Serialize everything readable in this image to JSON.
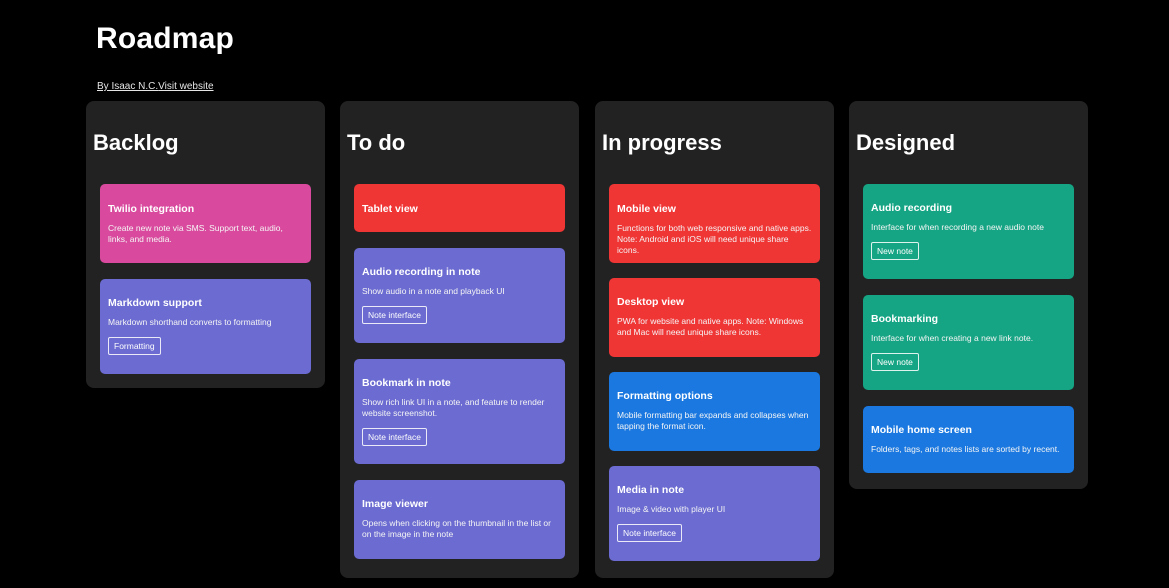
{
  "page": {
    "title": "Roadmap",
    "author": "By Isaac N.C.",
    "website_link": "Visit website"
  },
  "colors": {
    "background": "#000000",
    "column": "#222222",
    "pink": "#d94a9e",
    "purple": "#6b6bd1",
    "red": "#f03535",
    "blue": "#1a78e0",
    "teal": "#16a584"
  },
  "columns": [
    {
      "title": "Backlog",
      "cards": [
        {
          "title": "Twilio integration",
          "desc": "Create new note via SMS. Support text, audio, links, and media.",
          "tag": "",
          "color": "#d94a9e"
        },
        {
          "title": "Markdown support",
          "desc": "Markdown shorthand converts to formatting",
          "tag": "Formatting",
          "color": "#6b6bd1"
        }
      ]
    },
    {
      "title": "To do",
      "cards": [
        {
          "title": "Tablet view",
          "desc": "",
          "tag": "",
          "color": "#f03535"
        },
        {
          "title": "Audio recording in note",
          "desc": "Show audio in a note and playback UI",
          "tag": "Note interface",
          "color": "#6b6bd1"
        },
        {
          "title": "Bookmark in note",
          "desc": "Show rich link UI in a note, and feature to render website screenshot.",
          "tag": "Note interface",
          "color": "#6b6bd1"
        },
        {
          "title": "Image viewer",
          "desc": "Opens when clicking on the thumbnail in the list or on the image in the note",
          "tag": "",
          "color": "#6b6bd1"
        }
      ]
    },
    {
      "title": "In progress",
      "cards": [
        {
          "title": "Mobile view",
          "desc": "Functions for both web responsive and native apps. Note: Android and iOS will need unique share icons.",
          "tag": "",
          "color": "#f03535"
        },
        {
          "title": "Desktop view",
          "desc": "PWA for website and native apps. Note: Windows and Mac will need unique share icons.",
          "tag": "",
          "color": "#f03535"
        },
        {
          "title": "Formatting options",
          "desc": "Mobile formatting bar expands and collapses when tapping the format icon.",
          "tag": "",
          "color": "#1a78e0"
        },
        {
          "title": "Media in note",
          "desc": "Image & video with player UI",
          "tag": "Note interface",
          "color": "#6b6bd1"
        }
      ]
    },
    {
      "title": "Designed",
      "cards": [
        {
          "title": "Audio recording",
          "desc": "Interface for when recording a new audio note",
          "tag": "New note",
          "color": "#16a584"
        },
        {
          "title": "Bookmarking",
          "desc": "Interface for when creating a new link note.",
          "tag": "New note",
          "color": "#16a584"
        },
        {
          "title": "Mobile home screen",
          "desc": "Folders, tags, and notes lists are sorted by recent.",
          "tag": "",
          "color": "#1a78e0"
        }
      ]
    }
  ]
}
